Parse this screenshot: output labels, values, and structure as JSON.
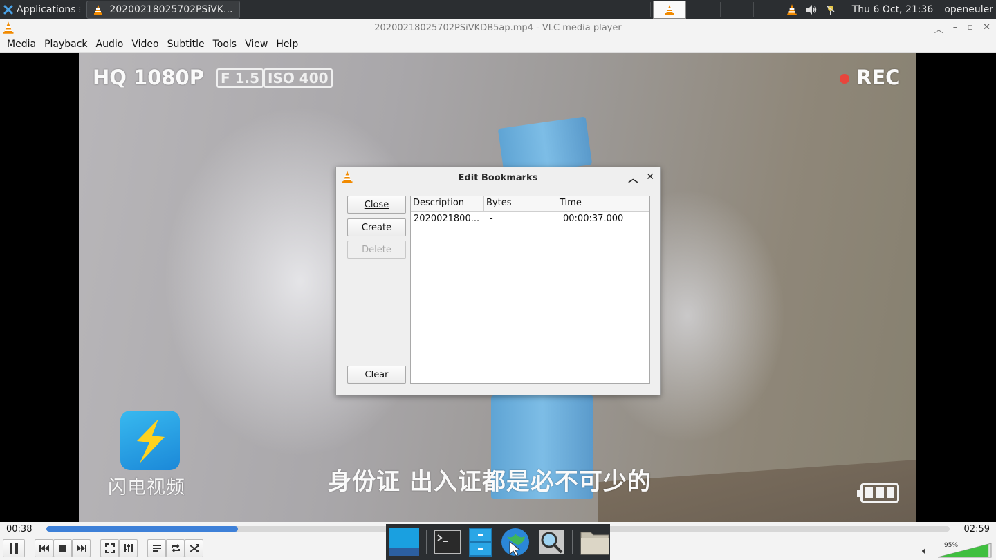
{
  "top_panel": {
    "applications_label": "Applications",
    "task_title": "20200218025702PSiVK...",
    "clock": "Thu  6 Oct, 21:36",
    "user": "openeuler"
  },
  "window": {
    "title": "20200218025702PSiVKDB5ap.mp4 - VLC media player",
    "menus": [
      "Media",
      "Playback",
      "Audio",
      "Video",
      "Subtitle",
      "Tools",
      "View",
      "Help"
    ]
  },
  "video": {
    "osd_quality": "HQ 1080P",
    "osd_fstop": "F 1.5",
    "osd_iso": "ISO 400",
    "osd_rec": "REC",
    "watermark": "闪电视频",
    "subtitle": "身份证 出入证都是必不可少的"
  },
  "dialog": {
    "title": "Edit Bookmarks",
    "buttons": {
      "close": "Close",
      "create": "Create",
      "delete": "Delete",
      "clear": "Clear"
    },
    "columns": [
      "Description",
      "Bytes",
      "Time"
    ],
    "rows": [
      {
        "description": "2020021800...",
        "bytes": "-",
        "time": "00:00:37.000"
      }
    ]
  },
  "player": {
    "elapsed": "00:38",
    "duration": "02:59",
    "progress": 0.212,
    "volume": "95%",
    "volume_level": 0.95
  },
  "colors": {
    "accent": "#3d80d8",
    "vlc_orange": "#f18a00",
    "volume_green": "#3fbf3f"
  }
}
